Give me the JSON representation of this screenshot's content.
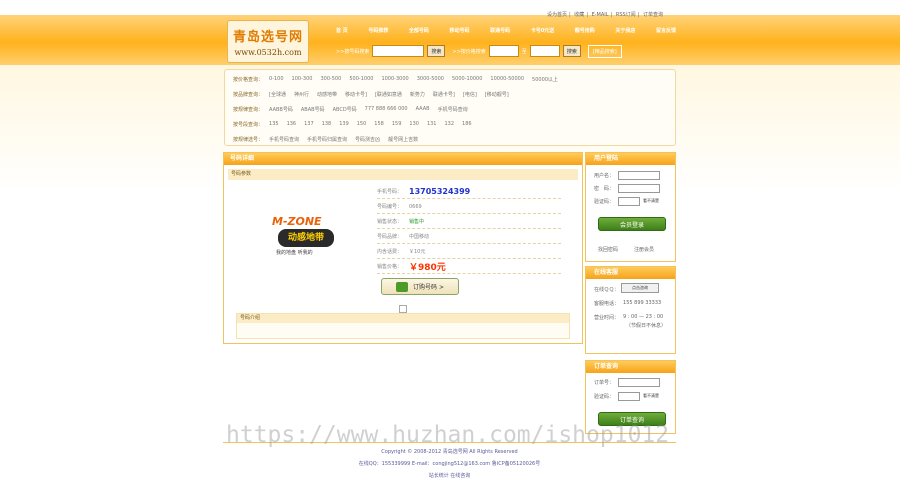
{
  "top_links": [
    "设为首页",
    "收藏",
    "E-MAIL",
    "RSS订阅",
    "订单查询"
  ],
  "logo": {
    "title": "青岛选号网",
    "url": "www.0532h.com"
  },
  "nav": [
    "首 页",
    "号码推荐",
    "全部号码",
    "移动号码",
    "联通号码",
    "卡号0元送",
    "靓号抢购",
    "关于我店",
    "留言反馈"
  ],
  "search": {
    "by_number_label": ">>按号码搜索",
    "search_button": "搜索",
    "by_price_label": ">>按价格搜索",
    "to_label": "至",
    "hint_button": "[精品搜索]"
  },
  "filters": [
    {
      "label": "按价格查询：",
      "items": [
        "0-100",
        "100-300",
        "300-500",
        "500-1000",
        "1000-3000",
        "3000-5000",
        "5000-10000",
        "10000-50000",
        "50000以上"
      ]
    },
    {
      "label": "按品牌查询：",
      "items": [
        "[全球通",
        "神州行",
        "动感地带",
        "移动卡号]",
        "[联通如意通",
        "新势力",
        "联通卡号]",
        "[电信]",
        "[移动靓号]"
      ]
    },
    {
      "label": "按规律查询：",
      "items": [
        "AABB号码",
        "ABAB号码",
        "ABCD号码",
        "777 888 666 000",
        "AAAB",
        "手机号码查询"
      ]
    },
    {
      "label": "按号段查询：",
      "items": [
        "135",
        "136",
        "137",
        "138",
        "139",
        "150",
        "158",
        "159",
        "130",
        "131",
        "132",
        "186"
      ]
    },
    {
      "label": "按规律选号：",
      "items": [
        "手机号码查询",
        "手机号码归属查询",
        "号码测吉凶",
        "靓号网上吉数"
      ]
    }
  ],
  "detail": {
    "header": "号码详细",
    "subheader": "号码参数",
    "rows": [
      {
        "key": "手机号码：",
        "value": "13705324399"
      },
      {
        "key": "号码编号：",
        "value": "0669"
      },
      {
        "key": "销售状态：",
        "value": "销售中"
      },
      {
        "key": "号码品牌：",
        "value": "中国移动"
      },
      {
        "key": "内含话费：",
        "value": "￥10元"
      },
      {
        "key": "销售价格：",
        "value": "￥980元"
      }
    ],
    "order_button": "订购号码 >",
    "mzone_text": "M-ZONE",
    "mzone_cn": "动感地带",
    "mzone_slogan": "我的地盘 听我的",
    "notes_header": "号码介绍"
  },
  "login": {
    "header": "用户登陆",
    "username_label": "用户名：",
    "password_label": "密　码：",
    "code_label": "验证码：",
    "code_image": "看不清楚",
    "login_button": "会员登录",
    "forgot": "找回密码",
    "register": "注册会员"
  },
  "contact": {
    "header": "在线客服",
    "qq_label": "在线ＱＱ：",
    "qq_badge": "点击咨询",
    "phone_label": "客服电话：",
    "phone": "155 899 33333",
    "hours_label": "营业时间：",
    "hours": "9 : 00 — 23 : 00",
    "hours_note": "（节假日不休息）"
  },
  "order_query": {
    "header": "订单查询",
    "order_label": "订单号：",
    "code_label": "验证码：",
    "code_image": "看不清楚",
    "query_button": "订单查询"
  },
  "footer": {
    "line1": "Copyright © 2008-2012 青岛选号网 All Rights Reserved",
    "line2": "在线QQ：155339999 E-mail：congjing512@163.com 鲁ICP备05120026号",
    "line3": "站长统计  在线咨询"
  },
  "watermark": "https://www.huzhan.com/ishop1012"
}
